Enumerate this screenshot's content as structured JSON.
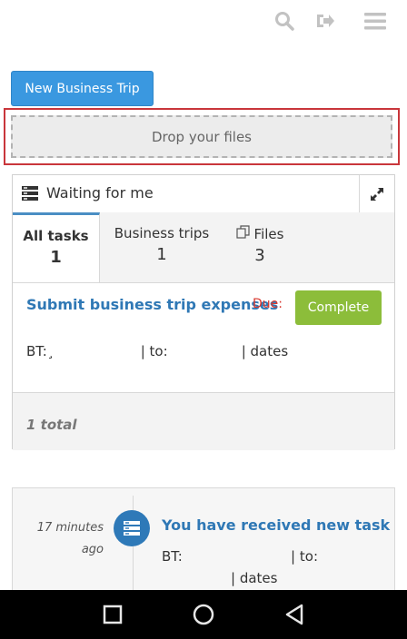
{
  "toolbar": {
    "search_icon": "search-icon",
    "logout_icon": "sign-out-icon",
    "menu_icon": "hamburger-menu-icon"
  },
  "actions": {
    "new_trip_label": "New Business Trip",
    "drop_label": "Drop your files"
  },
  "panel": {
    "title": "Waiting for me",
    "tabs": [
      {
        "label": "All tasks",
        "count": "1"
      },
      {
        "label": "Business trips",
        "count": "1"
      },
      {
        "label": "Files",
        "count": "3"
      }
    ],
    "task": {
      "title": "Submit business trip expenses",
      "due_label": "Due:",
      "complete_label": "Complete",
      "meta": "BT:¸                    | to:                 | dates"
    },
    "footer_total": "1 total"
  },
  "feed": {
    "time": "17 minutes ago",
    "title": "You have received new task",
    "meta_line1": "BT:                         | to:",
    "meta_line2": "| dates"
  },
  "colors": {
    "primary": "#3a98e0",
    "success": "#8cbd3a",
    "link": "#2f78b5",
    "danger": "#d9382e",
    "highlight_border": "#c9363b"
  }
}
